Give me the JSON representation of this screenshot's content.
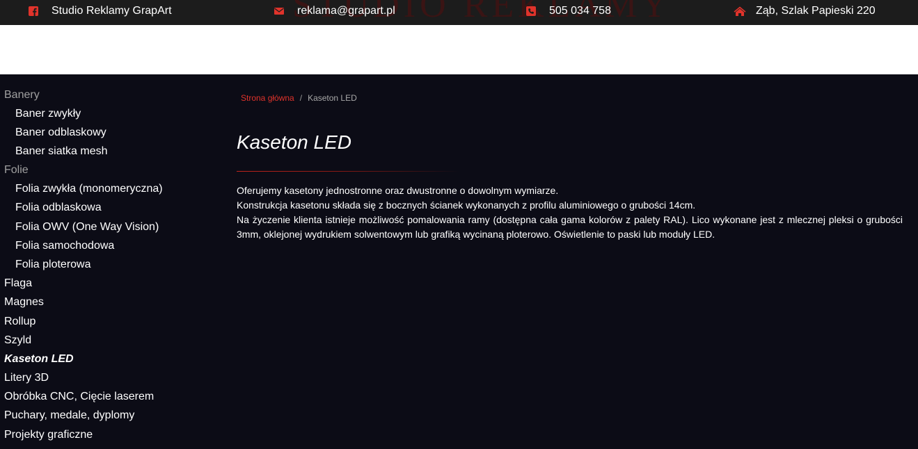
{
  "topbar": {
    "brand_watermark": "STUDIO REKLAMY",
    "contacts": [
      {
        "icon": "facebook-icon",
        "label": "Studio Reklamy GrapArt"
      },
      {
        "icon": "envelope-icon",
        "label": "reklama@grapart.pl"
      },
      {
        "icon": "phone-icon",
        "label": "505 034 758"
      },
      {
        "icon": "home-icon",
        "label": "Ząb, Szlak Papieski 220"
      }
    ],
    "icon_color": "#e0332b"
  },
  "sidebar": {
    "items": [
      {
        "label": "Banery",
        "kind": "category"
      },
      {
        "label": "Baner zwykły",
        "kind": "sub"
      },
      {
        "label": "Baner odblaskowy",
        "kind": "sub"
      },
      {
        "label": "Baner siatka mesh",
        "kind": "sub"
      },
      {
        "label": "Folie",
        "kind": "category"
      },
      {
        "label": "Folia zwykła (monomeryczna)",
        "kind": "sub"
      },
      {
        "label": "Folia odblaskowa",
        "kind": "sub"
      },
      {
        "label": "Folia OWV (One Way Vision)",
        "kind": "sub"
      },
      {
        "label": "Folia samochodowa",
        "kind": "sub"
      },
      {
        "label": "Folia ploterowa",
        "kind": "sub"
      },
      {
        "label": "Flaga",
        "kind": "top"
      },
      {
        "label": "Magnes",
        "kind": "top"
      },
      {
        "label": "Rollup",
        "kind": "top"
      },
      {
        "label": "Szyld",
        "kind": "top"
      },
      {
        "label": "Kaseton LED",
        "kind": "top",
        "active": true
      },
      {
        "label": "Litery 3D",
        "kind": "top"
      },
      {
        "label": "Obróbka CNC, Cięcie laserem",
        "kind": "top"
      },
      {
        "label": "Puchary, medale, dyplomy",
        "kind": "top"
      },
      {
        "label": "Projekty graficzne",
        "kind": "top"
      }
    ]
  },
  "breadcrumb": {
    "home": "Strona główna",
    "separator": "/",
    "current": "Kaseton LED"
  },
  "main": {
    "title": "Kaseton LED",
    "paragraphs": [
      "Oferujemy kasetony jednostronne oraz dwustronne o dowolnym wymiarze.",
      "Konstrukcja kasetonu składa się z bocznych ścianek wykonanych z profilu aluminiowego o grubości 14cm.",
      "Na życzenie klienta istnieje możliwość pomalowania ramy (dostępna cała gama kolorów z palety RAL). Lico wykonane jest z mlecznej pleksi o grubości 3mm, oklejonej wydrukiem solwentowym lub grafiką wycinaną ploterowo. Oświetlenie to paski lub moduły LED."
    ]
  },
  "colors": {
    "accent": "#e0332b",
    "background": "#0c0c16",
    "topbar": "#1c1c1c"
  }
}
